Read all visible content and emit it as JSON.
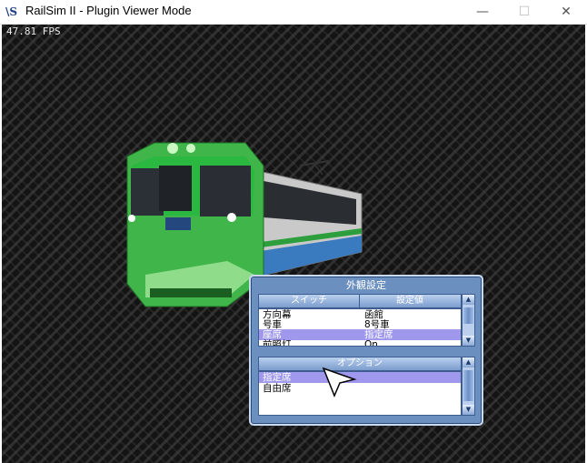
{
  "window": {
    "title": "RailSim II - Plugin Viewer Mode",
    "icon": "railsim-app-icon",
    "minimize_glyph": "—",
    "maximize_glyph": "☐",
    "close_glyph": "✕"
  },
  "viewport": {
    "fps": "47.81 FPS"
  },
  "panel": {
    "title": "外観設定",
    "columns": {
      "switch": "スイッチ",
      "value": "設定値"
    },
    "switch_rows": [
      {
        "name": "方向幕",
        "value": "函館"
      },
      {
        "name": "号車",
        "value": "8号車"
      },
      {
        "name": "座席",
        "value": "指定席"
      },
      {
        "name": "前照灯",
        "value": "On"
      }
    ],
    "selected_switch_index": 2,
    "options_header": "オプション",
    "options": [
      "指定席",
      "自由席"
    ],
    "selected_option_index": 0
  },
  "colors": {
    "train_green": "#3fb54a",
    "selection": "#9f98ec",
    "panel_blue": "#6b8fbf"
  }
}
